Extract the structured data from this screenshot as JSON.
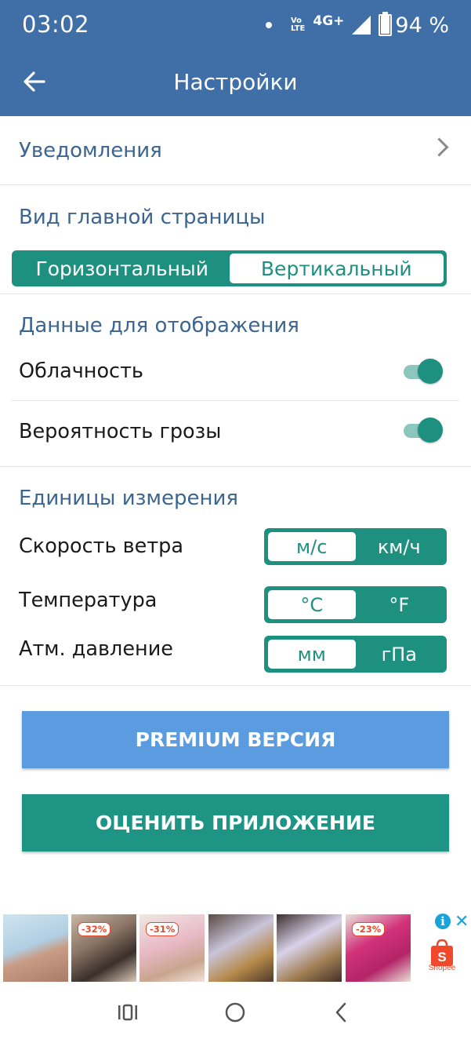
{
  "status_bar": {
    "time": "03:02",
    "network": "4G+",
    "volte_top": "Vo",
    "volte_bottom": "LTE",
    "battery": "94 %",
    "battery_level": 0.94
  },
  "app_bar": {
    "title": "Настройки"
  },
  "notifications_row": {
    "label": "Уведомления"
  },
  "home_view": {
    "title": "Вид главной страницы",
    "options": [
      "Горизонтальный",
      "Вертикальный"
    ],
    "selected": "Вертикальный"
  },
  "display_data": {
    "title": "Данные для отображения",
    "toggles": [
      {
        "label": "Облачность",
        "on": true
      },
      {
        "label": "Вероятность грозы",
        "on": true
      }
    ]
  },
  "units": {
    "title": "Единицы измерения",
    "rows": [
      {
        "label": "Скорость ветра",
        "options": [
          "м/с",
          "км/ч"
        ],
        "selected": "м/с"
      },
      {
        "label": "Температура",
        "options": [
          "°C",
          "°F"
        ],
        "selected": "°C"
      },
      {
        "label": "Атм. давление",
        "options": [
          "мм",
          "гПа"
        ],
        "selected": "мм"
      }
    ]
  },
  "buttons": {
    "premium": "PREMIUM ВЕРСИЯ",
    "rate": "ОЦЕНИТЬ ПРИЛОЖЕНИЕ"
  },
  "ad": {
    "badges": [
      "-32%",
      "-31%",
      "-23%"
    ],
    "brand": "Shopee",
    "info_icon": "i",
    "close_icon": "✕"
  },
  "colors": {
    "app_bar": "#3f6fa6",
    "accent": "#1e9080",
    "premium": "#5b9be0",
    "rate": "#1e9584",
    "section": "#3c6591"
  }
}
